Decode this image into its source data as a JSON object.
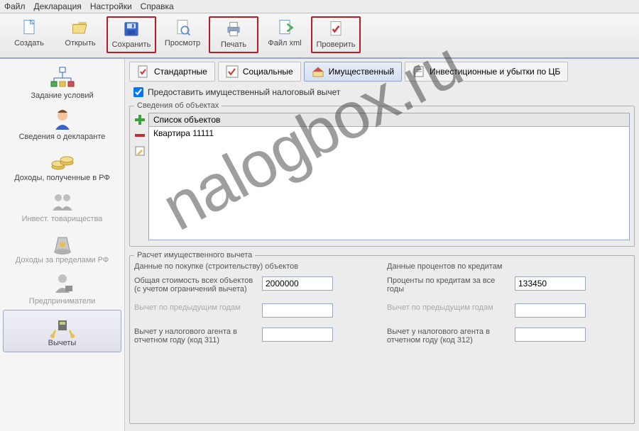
{
  "menu": {
    "items": [
      "Файл",
      "Декларация",
      "Настройки",
      "Справка"
    ]
  },
  "toolbar": {
    "create": "Создать",
    "open": "Открыть",
    "save": "Сохранить",
    "preview": "Просмотр",
    "print": "Печать",
    "xml": "Файл xml",
    "check": "Проверить"
  },
  "sidebar": {
    "conditions": "Задание условий",
    "declarant": "Сведения о декларанте",
    "income_rf": "Доходы, полученные в РФ",
    "invest_part": "Инвест. товарищества",
    "income_abroad": "Доходы за пределами РФ",
    "entrepreneur": "Предприниматели",
    "deductions": "Вычеты"
  },
  "tabs": {
    "standard": "Стандартные",
    "social": "Социальные",
    "property": "Имущественный",
    "invest": "Инвестиционные и убытки по ЦБ"
  },
  "checkbox_label": "Предоставить имущественный налоговый вычет",
  "objects": {
    "legend": "Сведения об объектах",
    "header": "Список объектов",
    "rows": [
      "Квартира 11111"
    ]
  },
  "calc": {
    "legend": "Расчет имущественного вычета",
    "left": {
      "title": "Данные по покупке (строительству) объектов",
      "total_label": "Общая стоимость всех объектов (с учетом ограничений вычета)",
      "total_value": "2000000",
      "prev_label": "Вычет по предыдущим годам",
      "prev_value": "",
      "agent_label": "Вычет у налогового агента в отчетном году (код 311)",
      "agent_value": ""
    },
    "right": {
      "title": "Данные процентов по кредитам",
      "total_label": "Проценты по кредитам за все годы",
      "total_value": "133450",
      "prev_label": "Вычет по предыдущим годам",
      "prev_value": "",
      "agent_label": "Вычет у налогового агента в отчетном году (код 312)",
      "agent_value": ""
    }
  },
  "watermark": "nalogbox.ru"
}
